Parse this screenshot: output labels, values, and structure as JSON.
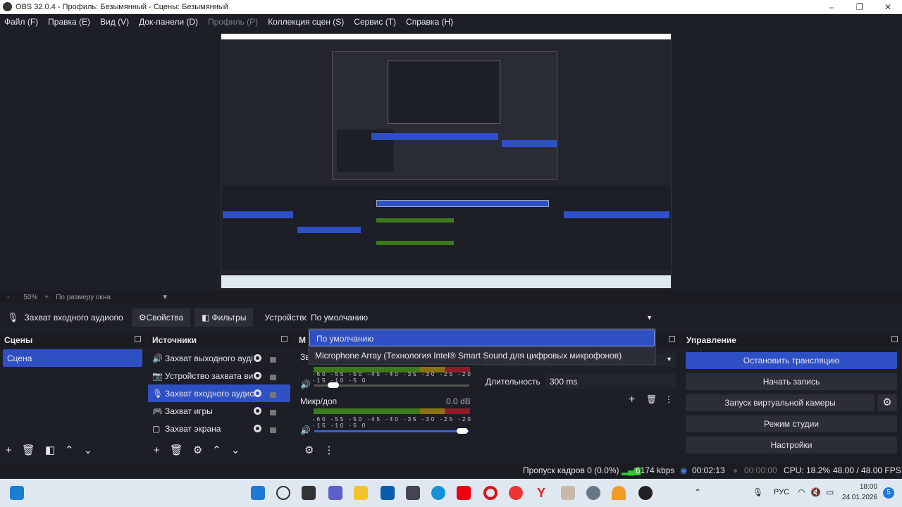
{
  "window": {
    "title": "OBS 32.0.4 - Профиль: Безымянный - Сцены: Безымянный"
  },
  "menu": [
    {
      "label": "Файл (F)"
    },
    {
      "label": "Правка (E)"
    },
    {
      "label": "Вид (V)"
    },
    {
      "label": "Док-панели (D)"
    },
    {
      "label": "Профиль (P)",
      "disabled": true
    },
    {
      "label": "Коллекция сцен (S)"
    },
    {
      "label": "Сервис (T)"
    },
    {
      "label": "Справка (H)"
    }
  ],
  "zoombar": {
    "minus": "-",
    "zoom": "50%",
    "plus": "+",
    "fit": "По размеру окна"
  },
  "source_toolbar": {
    "source_name": "Захват входного аудиопо",
    "properties": "Свойства",
    "filters": "Фильтры",
    "device_label": "Устройство",
    "device_value": "По умолчанию"
  },
  "dropdown": {
    "options": [
      "По умолчанию",
      "Microphone Array (Технология Intel® Smart Sound для цифровых микрофонов)"
    ],
    "selected": 0
  },
  "scenes": {
    "title": "Сцены",
    "items": [
      "Сцена"
    ]
  },
  "sources": {
    "title": "Источники",
    "items": [
      {
        "name": "Захват выходного ауді",
        "icon": "speaker-icon"
      },
      {
        "name": "Устройство захвата ви",
        "icon": "camera-icon"
      },
      {
        "name": "Захват входного аудис",
        "icon": "mic-icon",
        "selected": true
      },
      {
        "name": "Захват игры",
        "icon": "gamepad-icon"
      },
      {
        "name": "Захват экрана",
        "icon": "monitor-icon"
      }
    ]
  },
  "mixer": {
    "title": "М",
    "channels": [
      {
        "name": "Зв",
        "db": "",
        "volume": 0.1
      },
      {
        "name": "Микр/доп",
        "db": "0.0 dB",
        "volume": 1.0
      }
    ],
    "scale": "-60 -55 -50 -45 -40 -35 -30 -25 -20 -15 -10 -5 0"
  },
  "transitions": {
    "duration_label": "Длительность",
    "duration_value": "300 ms"
  },
  "controls": {
    "title": "Управление",
    "stop_stream": "Остановить трансляцию",
    "start_record": "Начать запись",
    "virtual_cam": "Запуск виртуальной камеры",
    "studio_mode": "Режим студии",
    "settings": "Настройки"
  },
  "status": {
    "dropped": "Пропуск кадров 0 (0.0%)",
    "bitrate": "6174 kbps",
    "stream_time": "00:02:13",
    "record_time": "00:00:00",
    "cpu": "CPU: 18.2%",
    "fps": "48.00 / 48.00 FPS"
  },
  "taskbar": {
    "lang": "РУС",
    "time": "18:00",
    "date": "24.01.2026",
    "badge": "5"
  },
  "colors": {
    "accent": "#2f4fc4",
    "bg": "#1d1f26",
    "panel": "#2b2e38"
  }
}
